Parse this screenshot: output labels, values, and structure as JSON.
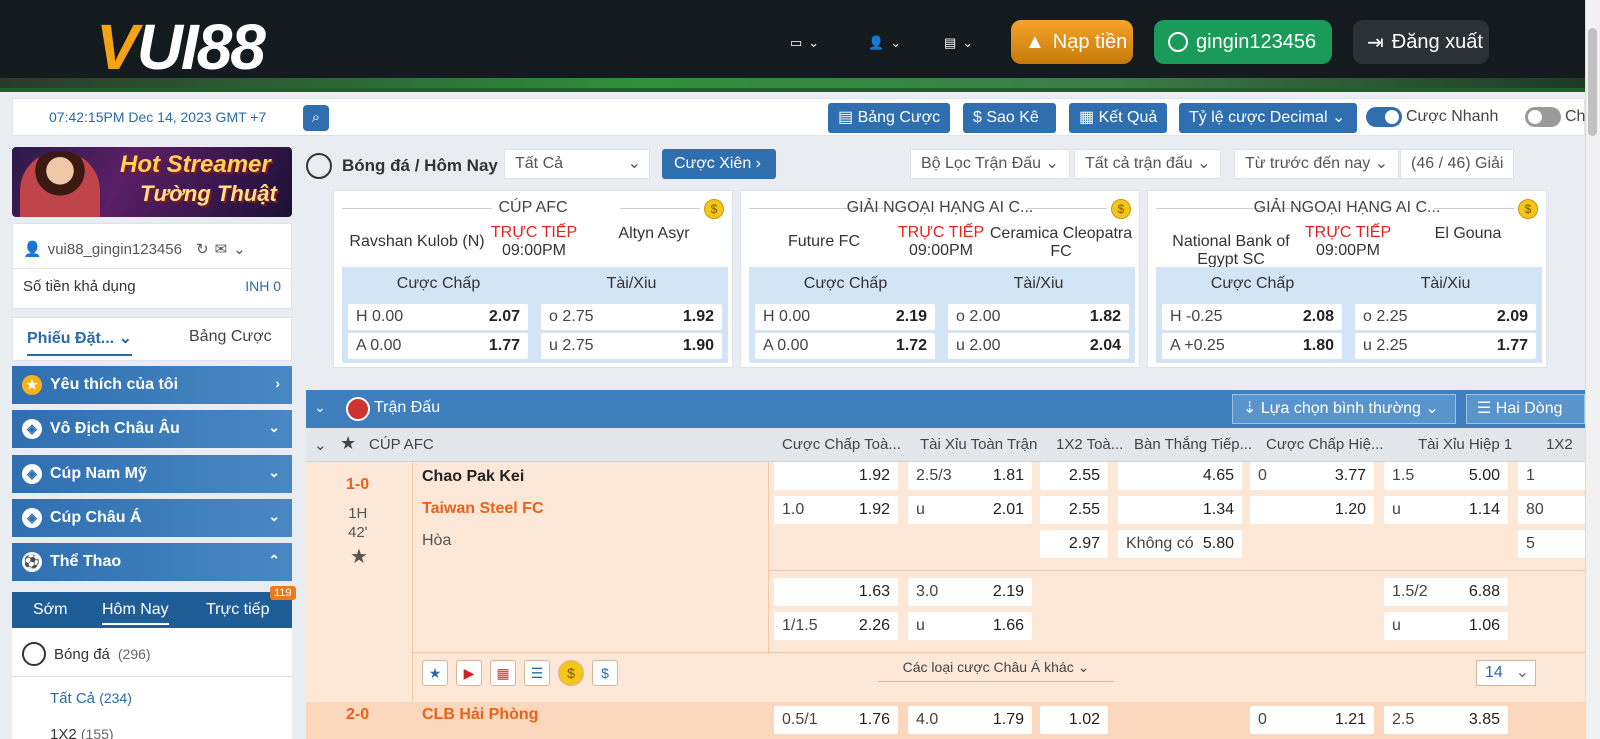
{
  "header": {
    "logo_text": "VUI88",
    "nap_tien_label": "Nạp tiền",
    "username": "gingin123456",
    "logout_label": "Đăng xuất",
    "colors": {
      "bg": "#141b1f",
      "nap": "#f0a020",
      "user": "#1a9b5a"
    }
  },
  "toolbar": {
    "datetime": "07:42:15PM Dec 14, 2023 GMT +7",
    "buttons": [
      "Bảng Cược",
      "Sao Kê",
      "Kết Quả",
      "Tỷ lệ cược Decimal"
    ],
    "quick_bet_label": "Cược Nhanh",
    "quick_bet_on": true,
    "toggle2_label": "Ch",
    "toggle2_on": false
  },
  "sidebar": {
    "banner_line1": "Hot Streamer",
    "banner_line2": "Tường Thuật",
    "account": "vui88_gingin123456",
    "balance_label": "Số tiền khả dụng",
    "balance_value": "INH 0",
    "tab_active": "Phiếu Đặt...",
    "tab_other": "Bảng Cược",
    "categories": [
      "Yêu thích của tôi",
      "Vô Địch Châu Âu",
      "Cúp Nam Mỹ",
      "Cúp Châu Á",
      "Thể Thao"
    ],
    "sub_tabs": [
      "Sớm",
      "Hôm Nay",
      "Trực tiếp"
    ],
    "live_count": "119",
    "sport_name": "Bóng đá",
    "sport_count": "(296)",
    "all_label": "Tất Cả",
    "all_count": "(234)",
    "x12_label": "1X2",
    "x12_count": "(155)"
  },
  "main": {
    "sport_title": "Bóng đá / Hôm Nay",
    "filter_all": "Tất Cả",
    "xien_label": "Cược Xiên",
    "filter_match": "Bộ Lọc Trận Đấu",
    "filter_all_matches": "Tất cả trận đấu",
    "sort_label": "Từ trước đến nay",
    "league_count": "(46 / 46) Giải"
  },
  "cards": [
    {
      "league": "CÚP AFC",
      "home": "Ravshan Kulob (N)",
      "status": "TRỰC TIẾP",
      "time": "09:00PM",
      "away": "Altyn Asyr",
      "h_label": "Cược Chấp",
      "t_label": "Tài/Xiu",
      "h1": "H 0.00",
      "h1o": "2.07",
      "h2": "A 0.00",
      "h2o": "1.77",
      "t1": "o 2.75",
      "t1o": "1.92",
      "t2": "u 2.75",
      "t2o": "1.90"
    },
    {
      "league": "GIẢI NGOẠI HẠNG AI C...",
      "home": "Future FC",
      "status": "TRỰC TIẾP",
      "time": "09:00PM",
      "away": "Ceramica Cleopatra FC",
      "h_label": "Cược Chấp",
      "t_label": "Tài/Xiu",
      "h1": "H 0.00",
      "h1o": "2.19",
      "h2": "A 0.00",
      "h2o": "1.72",
      "t1": "o 2.00",
      "t1o": "1.82",
      "t2": "u 2.00",
      "t2o": "2.04"
    },
    {
      "league": "GIẢI NGOẠI HẠNG AI C...",
      "home": "National Bank of Egypt SC",
      "status": "TRỰC TIẾP",
      "time": "09:00PM",
      "away": "El Gouna",
      "h_label": "Cược Chấp",
      "t_label": "Tài/Xiu",
      "h1": "H -0.25",
      "h1o": "2.08",
      "h2": "A +0.25",
      "h2o": "1.80",
      "t1": "o 2.25",
      "t1o": "2.09",
      "t2": "u 2.25",
      "t2o": "1.77"
    }
  ],
  "table": {
    "section_title": "Trận Đấu",
    "choice_label": "Lựa chọn bình thường",
    "lines_label": "Hai Dòng",
    "league": "CÚP AFC",
    "columns": [
      "Cược Chấp Toà...",
      "Tài Xỉu Toàn Trận",
      "1X2 Toà...",
      "Bàn Thắng Tiếp...",
      "Cược Chấp Hiệ...",
      "Tài Xỉu Hiệp 1",
      "1X2"
    ],
    "match1": {
      "score": "1-0",
      "period": "1H",
      "minute": "42'",
      "home": "Chao Pak Kei",
      "away": "Taiwan Steel FC",
      "draw": "Hòa",
      "hdp_a": [
        "",
        "1.92",
        "1.0",
        "1.92"
      ],
      "ou_a": [
        "2.5/3",
        "1.81",
        "u",
        "2.01"
      ],
      "x12": [
        "2.55",
        "2.55",
        "2.97"
      ],
      "next_goal": [
        "4.65",
        "1.34",
        "5.80"
      ],
      "no_goal_label": "Không có",
      "h1_hdp": [
        "0",
        "3.77",
        "",
        "1.20"
      ],
      "h1_ou": [
        "1.5",
        "5.00",
        "u",
        "1.14"
      ],
      "h1_x12": [
        "1",
        "80",
        "5"
      ],
      "hdp_b": [
        "",
        "1.63",
        "1/1.5",
        "2.26"
      ],
      "ou_b": [
        "3.0",
        "2.19",
        "u",
        "1.66"
      ],
      "h1_ou_b": [
        "1.5/2",
        "6.88",
        "u",
        "1.06"
      ],
      "more_label": "Các loại cược Châu Á khác",
      "more_count": "14"
    },
    "match2": {
      "score": "2-0",
      "home": "CLB Hải Phòng",
      "hdp": [
        "0.5/1",
        "1.76"
      ],
      "ou": [
        "4.0",
        "1.79"
      ],
      "x12": "1.02",
      "h1_hdp": [
        "0",
        "1.21"
      ],
      "h1_ou": [
        "2.5",
        "3.85"
      ]
    }
  }
}
